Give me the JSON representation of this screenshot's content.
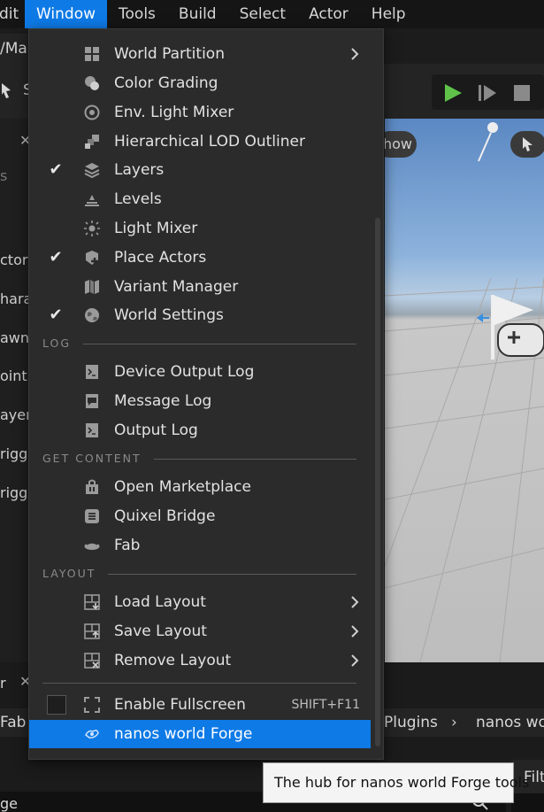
{
  "menubar": {
    "items": [
      "dit",
      "Window",
      "Tools",
      "Build",
      "Select",
      "Actor",
      "Help"
    ],
    "active": "Window"
  },
  "background": {
    "left_tab": "/Map",
    "toolbar_text": "S",
    "viewport_label": "how",
    "left_panel": [
      "ctor",
      "hara",
      "awn",
      "oint",
      "ayer",
      "rigge",
      "rigge"
    ],
    "search_placeholder": "s",
    "left_bottom": "r",
    "content_bar": {
      "left": "Fab",
      "crumb1": "Plugins",
      "crumb2": "nanos wo"
    },
    "bottom_right": "Filt",
    "bottom_left": "ge"
  },
  "window_menu": {
    "items_top": [
      {
        "label": "World Partition",
        "icon": "world-partition-icon",
        "checked": false,
        "submenu": true
      },
      {
        "label": "Color Grading",
        "icon": "color-grading-icon",
        "checked": false
      },
      {
        "label": "Env. Light Mixer",
        "icon": "env-light-mixer-icon",
        "checked": false
      },
      {
        "label": "Hierarchical LOD Outliner",
        "icon": "hlod-outliner-icon",
        "checked": false
      },
      {
        "label": "Layers",
        "icon": "layers-icon",
        "checked": true
      },
      {
        "label": "Levels",
        "icon": "levels-icon",
        "checked": false
      },
      {
        "label": "Light Mixer",
        "icon": "light-mixer-icon",
        "checked": false
      },
      {
        "label": "Place Actors",
        "icon": "place-actors-icon",
        "checked": true
      },
      {
        "label": "Variant Manager",
        "icon": "variant-manager-icon",
        "checked": false
      },
      {
        "label": "World Settings",
        "icon": "world-settings-icon",
        "checked": true
      }
    ],
    "section_log": "LOG",
    "items_log": [
      {
        "label": "Device Output Log",
        "icon": "device-output-log-icon"
      },
      {
        "label": "Message Log",
        "icon": "message-log-icon"
      },
      {
        "label": "Output Log",
        "icon": "output-log-icon"
      }
    ],
    "section_content": "GET CONTENT",
    "items_content": [
      {
        "label": "Open Marketplace",
        "icon": "marketplace-icon"
      },
      {
        "label": "Quixel Bridge",
        "icon": "quixel-bridge-icon"
      },
      {
        "label": "Fab",
        "icon": "fab-icon"
      }
    ],
    "section_layout": "LAYOUT",
    "items_layout": [
      {
        "label": "Load Layout",
        "icon": "load-layout-icon"
      },
      {
        "label": "Save Layout",
        "icon": "save-layout-icon"
      },
      {
        "label": "Remove Layout",
        "icon": "remove-layout-icon"
      }
    ],
    "fullscreen": {
      "label": "Enable Fullscreen",
      "shortcut": "SHIFT+F11",
      "checked": false
    },
    "forge": {
      "label": "nanos world Forge",
      "icon": "nanos-forge-icon"
    }
  },
  "tooltip": {
    "text": "The hub for nanos world Forge tools"
  },
  "colors": {
    "accent": "#0e7ae6",
    "menu_bg": "#2b2b2b",
    "menubar_bg": "#151515",
    "play_green": "#5fc34a"
  }
}
